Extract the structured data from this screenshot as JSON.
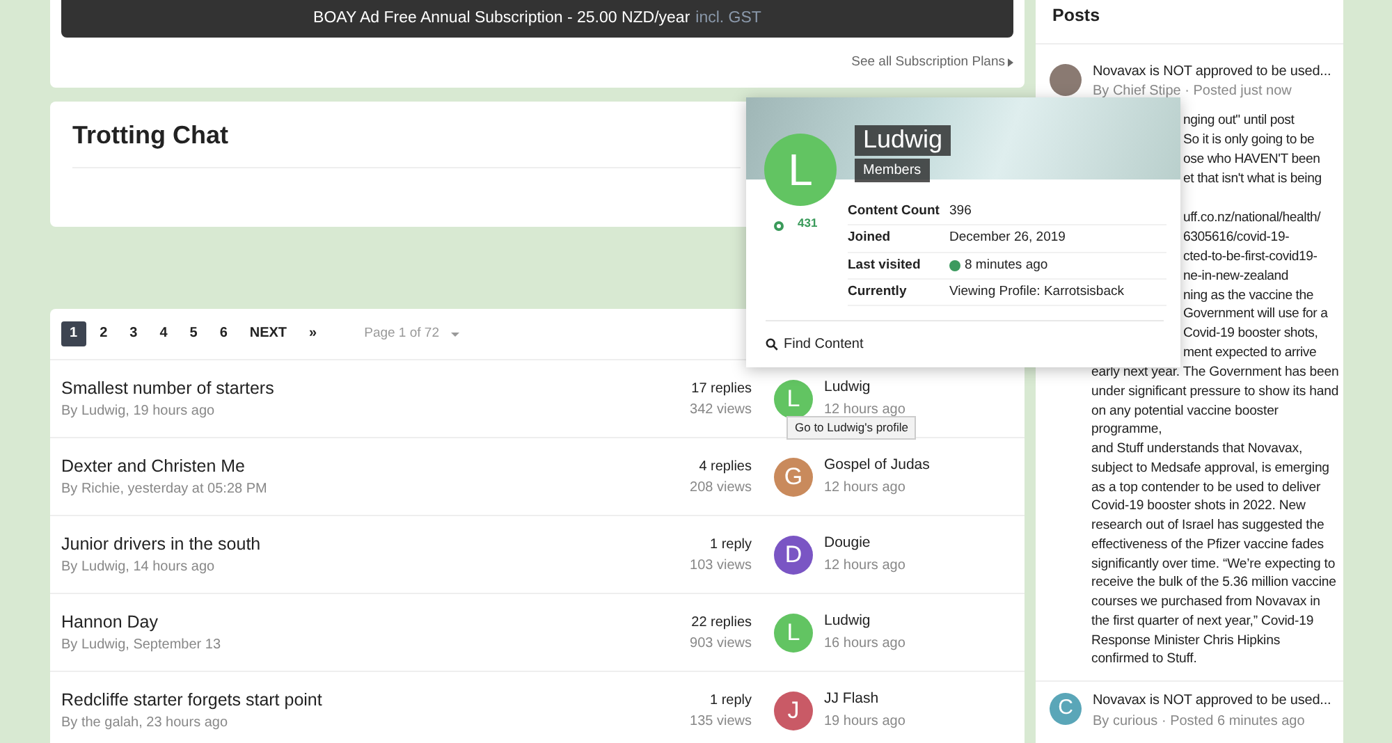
{
  "subscription": {
    "label": "BOAY Ad Free Annual Subscription - 25.00 NZD/year",
    "tax_note": "incl. GST",
    "plans_link": "See all Subscription Plans"
  },
  "chat": {
    "title": "Trotting Chat"
  },
  "pagination": {
    "pages": [
      {
        "label": "1",
        "selected": true
      },
      {
        "label": "2",
        "selected": false
      },
      {
        "label": "3",
        "selected": false
      },
      {
        "label": "4",
        "selected": false
      },
      {
        "label": "5",
        "selected": false
      },
      {
        "label": "6",
        "selected": false
      }
    ],
    "next": "NEXT",
    "last": "»",
    "jump": "Page 1 of 72"
  },
  "topics": [
    {
      "title": "Smallest number of starters",
      "meta": "By Ludwig, 19 hours ago",
      "replies": "17 replies",
      "views": "342 views",
      "last_initial": "L",
      "color": "#62c462",
      "last_user": "Ludwig",
      "last_time": "12 hours ago"
    },
    {
      "title": "Dexter and Christen Me",
      "meta": "By Richie, yesterday at 05:28 PM",
      "replies": "4 replies",
      "views": "208 views",
      "last_initial": "G",
      "color": "#c98a5c",
      "last_user": "Gospel of Judas",
      "last_time": "12 hours ago"
    },
    {
      "title": "Junior drivers in the south",
      "meta": "By Ludwig, 14 hours ago",
      "replies": "1 reply",
      "views": "103 views",
      "last_initial": "D",
      "color": "#7a55c4",
      "last_user": "Dougie",
      "last_time": "12 hours ago"
    },
    {
      "title": "Hannon Day",
      "meta": "By Ludwig, September 13",
      "replies": "22 replies",
      "views": "903 views",
      "last_initial": "L",
      "color": "#62c462",
      "last_user": "Ludwig",
      "last_time": "16 hours ago"
    },
    {
      "title": "Redcliffe starter forgets start point",
      "meta": "By the galah, 23 hours ago",
      "replies": "1 reply",
      "views": "135 views",
      "last_initial": "J",
      "color": "#c95a66",
      "last_user": "JJ Flash",
      "last_time": "19 hours ago"
    }
  ],
  "tooltip": "Go to Ludwig's profile",
  "profile_card": {
    "name": "Ludwig",
    "group": "Members",
    "initial": "L",
    "reputation": "431",
    "fields": [
      {
        "label": "Content Count",
        "value": "396",
        "online": false
      },
      {
        "label": "Joined",
        "value": "December 26, 2019",
        "online": false
      },
      {
        "label": "Last visited",
        "value": "8 minutes ago",
        "online": true
      },
      {
        "label": "Currently",
        "value": "Viewing Profile: Karrotsisback",
        "online": false
      }
    ],
    "find_content": "Find Content"
  },
  "posts": {
    "title": "Posts",
    "items": [
      {
        "kind": "photo",
        "title": "Novavax is NOT approved to be used...",
        "meta": "By Chief Stipe · Posted just now",
        "hidden_lines": [
          "nging out\" until post",
          "So it is only going to be",
          "ose who HAVEN'T been",
          "et that isn't what is being",
          "uff.co.nz/national/health/",
          "6305616/covid-19-",
          "cted-to-be-first-covid19-",
          "ne-in-new-zealand",
          "ning as the vaccine the",
          "Government will use for a",
          "Covid-19 booster shots,",
          "ment expected to arrive"
        ],
        "paragraphs": [
          "early next year. The Government has been under significant pressure to show its hand on any potential vaccine booster programme,",
          "and Stuff understands that Novavax, subject to Medsafe approval, is emerging as a top contender to be used to deliver Covid-19 booster shots in 2022. New research out of Israel has suggested the effectiveness of the Pfizer vaccine fades significantly over time.   “We’re expecting to receive the bulk of the 5.36 million vaccine courses we purchased from Novavax in the first quarter of next year,” Covid-19 Response Minister Chris Hipkins confirmed to Stuff."
        ]
      },
      {
        "kind": "letter",
        "initial": "C",
        "color": "#5aa6b8",
        "title": "Novavax is NOT approved to be used...",
        "meta": "By curious · Posted 6 minutes ago"
      }
    ]
  }
}
